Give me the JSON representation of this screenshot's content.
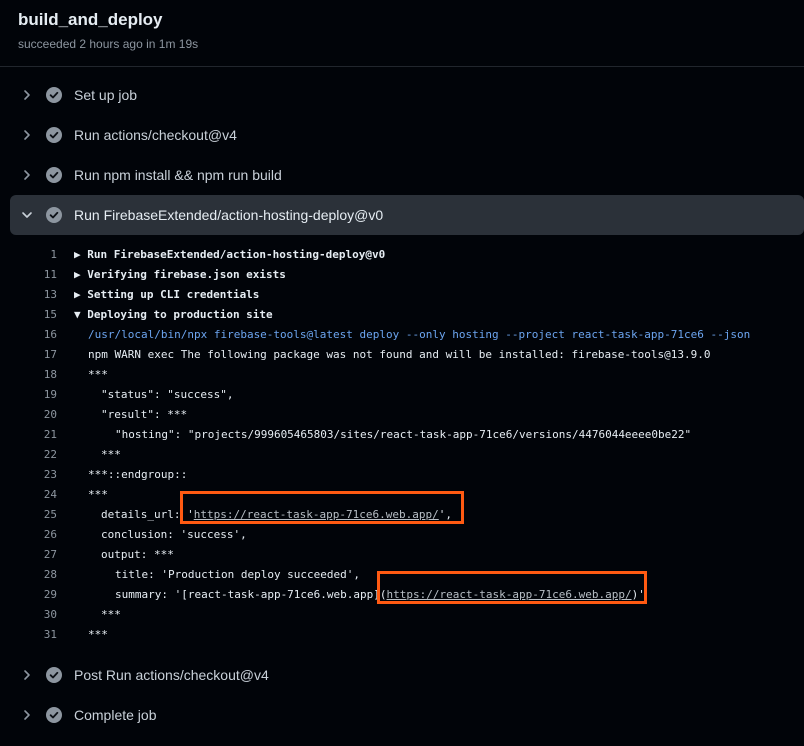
{
  "header": {
    "title": "build_and_deploy",
    "subtitle": "succeeded 2 hours ago in 1m 19s"
  },
  "steps_before": [
    {
      "label": "Set up job"
    },
    {
      "label": "Run actions/checkout@v4"
    },
    {
      "label": "Run npm install && npm run build"
    }
  ],
  "expanded_step": {
    "label": "Run FirebaseExtended/action-hosting-deploy@v0"
  },
  "log": {
    "l1": {
      "num": "1",
      "text": "▶ Run FirebaseExtended/action-hosting-deploy@v0"
    },
    "l11": {
      "num": "11",
      "text": "▶ Verifying firebase.json exists"
    },
    "l13": {
      "num": "13",
      "text": "▶ Setting up CLI credentials"
    },
    "l15": {
      "num": "15",
      "text": "▼ Deploying to production site"
    },
    "l16": {
      "num": "16",
      "text": "/usr/local/bin/npx firebase-tools@latest deploy --only hosting --project react-task-app-71ce6 --json"
    },
    "l17": {
      "num": "17",
      "text": "npm WARN exec The following package was not found and will be installed: firebase-tools@13.9.0"
    },
    "l18": {
      "num": "18",
      "text": "***"
    },
    "l19": {
      "num": "19",
      "text": "\"status\": \"success\","
    },
    "l20": {
      "num": "20",
      "text": "\"result\": ***"
    },
    "l21": {
      "num": "21",
      "text": "\"hosting\": \"projects/999605465803/sites/react-task-app-71ce6/versions/4476044eeee0be22\""
    },
    "l22": {
      "num": "22",
      "text": "***"
    },
    "l23": {
      "num": "23",
      "text": "***::endgroup::"
    },
    "l24": {
      "num": "24",
      "text": "***"
    },
    "l25": {
      "num": "25",
      "pre": "details_url: '",
      "link": "https://react-task-app-71ce6.web.app/",
      "post": "',"
    },
    "l26": {
      "num": "26",
      "text": "conclusion: 'success',"
    },
    "l27": {
      "num": "27",
      "text": "output: ***"
    },
    "l28": {
      "num": "28",
      "text": "title: 'Production deploy succeeded',"
    },
    "l29": {
      "num": "29",
      "pre": "summary: '[react-task-app-71ce6.web.app](",
      "link": "https://react-task-app-71ce6.web.app/",
      "post": ")'"
    },
    "l30": {
      "num": "30",
      "text": "***"
    },
    "l31": {
      "num": "31",
      "text": "***"
    }
  },
  "steps_after": [
    {
      "label": "Post Run actions/checkout@v4"
    },
    {
      "label": "Complete job"
    }
  ],
  "colors": {
    "background": "#010409",
    "expanded_row": "#2b3139",
    "highlight": "#ff5a12",
    "command_blue": "#6ca5f0"
  },
  "icons": {
    "collapsed": "chevron-right-icon",
    "expanded": "chevron-down-icon",
    "status": "check-circle-icon"
  }
}
